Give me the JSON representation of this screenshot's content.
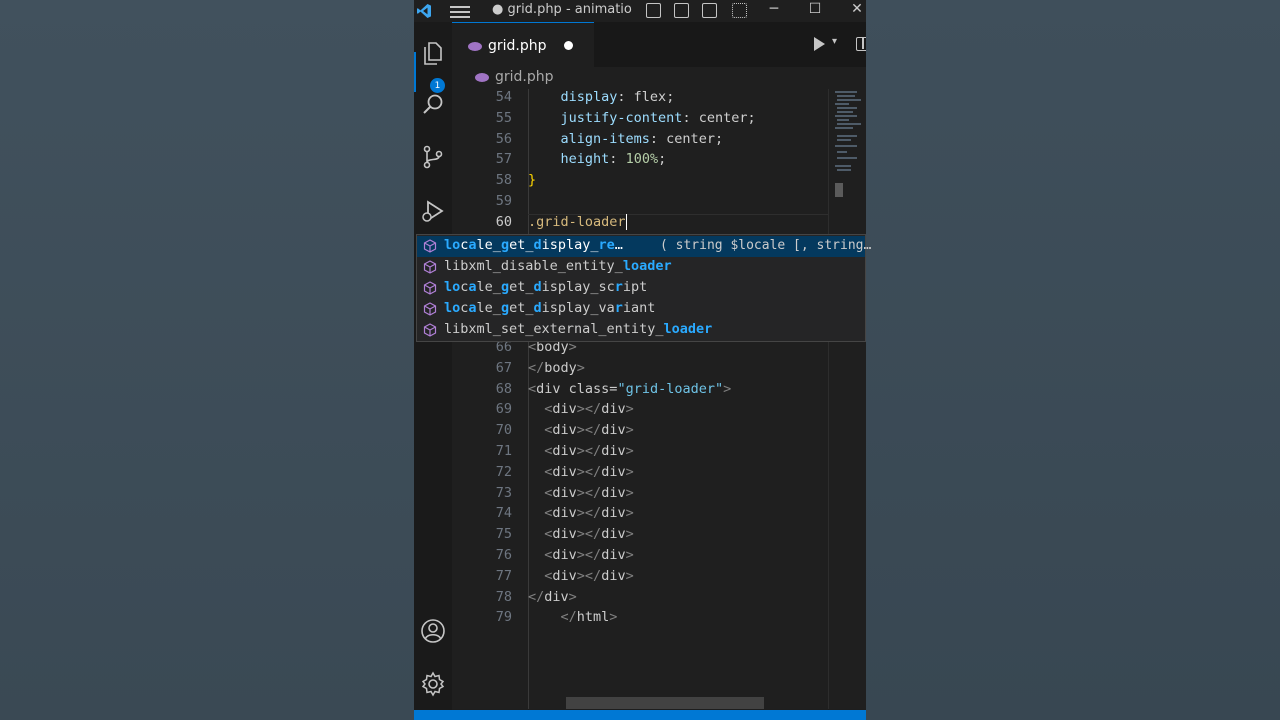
{
  "titlebar": {
    "title": "● grid.php - animatio...",
    "menu_icon": "hamburger-menu-icon",
    "minimize": "─",
    "maximize": "☐",
    "close": "✕"
  },
  "activity": {
    "explorer_badge": "1",
    "icons": [
      "files-icon",
      "search-icon",
      "source-control-icon",
      "run-debug-icon",
      "account-icon",
      "settings-gear-icon"
    ]
  },
  "tab": {
    "label": "grid.php",
    "dirty": true
  },
  "breadcrumb": {
    "file": "grid.php"
  },
  "code_lines": [
    {
      "n": "54",
      "parts": [
        [
          "",
          "    "
        ],
        [
          "prop",
          "display"
        ],
        [
          "val",
          ": flex;"
        ]
      ]
    },
    {
      "n": "55",
      "parts": [
        [
          "",
          "    "
        ],
        [
          "prop",
          "justify-content"
        ],
        [
          "val",
          ": center;"
        ]
      ]
    },
    {
      "n": "56",
      "parts": [
        [
          "",
          "    "
        ],
        [
          "prop",
          "align-items"
        ],
        [
          "val",
          ": center;"
        ]
      ]
    },
    {
      "n": "57",
      "parts": [
        [
          "",
          "    "
        ],
        [
          "prop",
          "height"
        ],
        [
          "val",
          ": "
        ],
        [
          "num",
          "100%"
        ],
        [
          "val",
          ";"
        ]
      ]
    },
    {
      "n": "58",
      "parts": [
        [
          "brace",
          "}"
        ]
      ]
    },
    {
      "n": "59",
      "parts": []
    },
    {
      "n": "60",
      "parts": [
        [
          "sel",
          ".grid-loader"
        ]
      ],
      "cursor": true
    },
    {
      "n": "66",
      "parts": [
        [
          "tag",
          "<"
        ],
        [
          "tagname",
          "body"
        ],
        [
          "tag",
          ">"
        ]
      ]
    },
    {
      "n": "67",
      "parts": [
        [
          "tag",
          "</"
        ],
        [
          "tagname",
          "body"
        ],
        [
          "tag",
          ">"
        ]
      ]
    },
    {
      "n": "68",
      "parts": [
        [
          "tag",
          "<"
        ],
        [
          "tagname",
          "div"
        ],
        [
          "attr",
          " class="
        ],
        [
          "str",
          "\"grid-loader\""
        ],
        [
          "tag",
          ">"
        ]
      ]
    },
    {
      "n": "69",
      "parts": [
        [
          "",
          "  "
        ],
        [
          "tag",
          "<"
        ],
        [
          "tagname",
          "div"
        ],
        [
          "tag",
          "></"
        ],
        [
          "tagname",
          "div"
        ],
        [
          "tag",
          ">"
        ]
      ]
    },
    {
      "n": "70",
      "parts": [
        [
          "",
          "  "
        ],
        [
          "tag",
          "<"
        ],
        [
          "tagname",
          "div"
        ],
        [
          "tag",
          "></"
        ],
        [
          "tagname",
          "div"
        ],
        [
          "tag",
          ">"
        ]
      ]
    },
    {
      "n": "71",
      "parts": [
        [
          "",
          "  "
        ],
        [
          "tag",
          "<"
        ],
        [
          "tagname",
          "div"
        ],
        [
          "tag",
          "></"
        ],
        [
          "tagname",
          "div"
        ],
        [
          "tag",
          ">"
        ]
      ]
    },
    {
      "n": "72",
      "parts": [
        [
          "",
          "  "
        ],
        [
          "tag",
          "<"
        ],
        [
          "tagname",
          "div"
        ],
        [
          "tag",
          "></"
        ],
        [
          "tagname",
          "div"
        ],
        [
          "tag",
          ">"
        ]
      ]
    },
    {
      "n": "73",
      "parts": [
        [
          "",
          "  "
        ],
        [
          "tag",
          "<"
        ],
        [
          "tagname",
          "div"
        ],
        [
          "tag",
          "></"
        ],
        [
          "tagname",
          "div"
        ],
        [
          "tag",
          ">"
        ]
      ]
    },
    {
      "n": "74",
      "parts": [
        [
          "",
          "  "
        ],
        [
          "tag",
          "<"
        ],
        [
          "tagname",
          "div"
        ],
        [
          "tag",
          "></"
        ],
        [
          "tagname",
          "div"
        ],
        [
          "tag",
          ">"
        ]
      ]
    },
    {
      "n": "75",
      "parts": [
        [
          "",
          "  "
        ],
        [
          "tag",
          "<"
        ],
        [
          "tagname",
          "div"
        ],
        [
          "tag",
          "></"
        ],
        [
          "tagname",
          "div"
        ],
        [
          "tag",
          ">"
        ]
      ]
    },
    {
      "n": "76",
      "parts": [
        [
          "",
          "  "
        ],
        [
          "tag",
          "<"
        ],
        [
          "tagname",
          "div"
        ],
        [
          "tag",
          "></"
        ],
        [
          "tagname",
          "div"
        ],
        [
          "tag",
          ">"
        ]
      ]
    },
    {
      "n": "77",
      "parts": [
        [
          "",
          "  "
        ],
        [
          "tag",
          "<"
        ],
        [
          "tagname",
          "div"
        ],
        [
          "tag",
          "></"
        ],
        [
          "tagname",
          "div"
        ],
        [
          "tag",
          ">"
        ]
      ]
    },
    {
      "n": "78",
      "parts": [
        [
          "tag",
          "</"
        ],
        [
          "tagname",
          "div"
        ],
        [
          "tag",
          ">"
        ]
      ]
    },
    {
      "n": "79",
      "parts": [
        [
          "",
          "    "
        ],
        [
          "tag",
          "</"
        ],
        [
          "tagname",
          "html"
        ],
        [
          "tag",
          ">"
        ]
      ]
    }
  ],
  "suggestions": [
    {
      "segments": [
        [
          "hl",
          "lo"
        ],
        [
          "",
          "c"
        ],
        [
          "hl",
          "a"
        ],
        [
          "",
          "le_"
        ],
        [
          "hl",
          "g"
        ],
        [
          "",
          "et_"
        ],
        [
          "hl",
          "d"
        ],
        [
          "",
          "isplay_"
        ],
        [
          "hl",
          "re"
        ],
        [
          "",
          "…"
        ]
      ],
      "detail": "( string $locale [, string…",
      "active": true
    },
    {
      "segments": [
        [
          "",
          "libxml_disable_entity_"
        ],
        [
          "hl",
          "loader"
        ]
      ],
      "detail": ""
    },
    {
      "segments": [
        [
          "hl",
          "lo"
        ],
        [
          "",
          "c"
        ],
        [
          "hl",
          "a"
        ],
        [
          "",
          "le_"
        ],
        [
          "hl",
          "g"
        ],
        [
          "",
          "et_"
        ],
        [
          "hl",
          "d"
        ],
        [
          "",
          "isplay_sc"
        ],
        [
          "hl",
          "r"
        ],
        [
          "",
          "ipt"
        ]
      ],
      "detail": ""
    },
    {
      "segments": [
        [
          "hl",
          "lo"
        ],
        [
          "",
          "c"
        ],
        [
          "hl",
          "a"
        ],
        [
          "",
          "le_"
        ],
        [
          "hl",
          "g"
        ],
        [
          "",
          "et_"
        ],
        [
          "hl",
          "d"
        ],
        [
          "",
          "isplay_va"
        ],
        [
          "hl",
          "r"
        ],
        [
          "",
          "iant"
        ]
      ],
      "detail": ""
    },
    {
      "segments": [
        [
          "",
          "libxml_set_external_entity_"
        ],
        [
          "hl",
          "loader"
        ]
      ],
      "detail": ""
    }
  ],
  "colors": {
    "accent": "#0078d4",
    "editor_bg": "#1f1f1f",
    "suggest_active_bg": "#04395e",
    "match_highlight": "#2aaaff"
  }
}
